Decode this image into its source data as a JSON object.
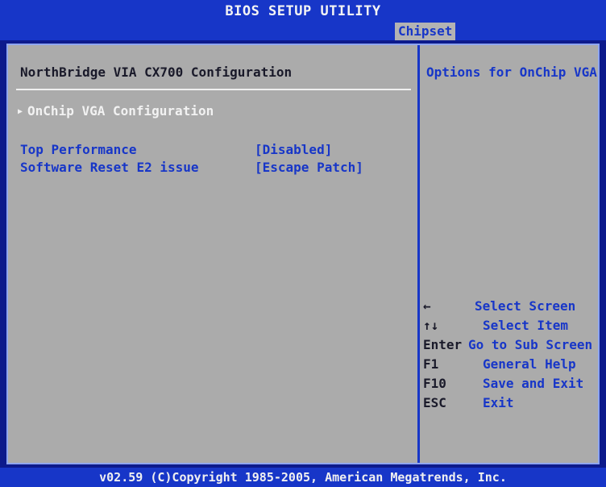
{
  "title": "BIOS SETUP UTILITY",
  "active_tab": "Chipset",
  "section_title": "NorthBridge VIA CX700 Configuration",
  "submenu": {
    "label": "OnChip VGA Configuration"
  },
  "settings": [
    {
      "label": "Top Performance",
      "value": "[Disabled]"
    },
    {
      "label": "Software Reset E2 issue",
      "value": "[Escape Patch]"
    }
  ],
  "help": "Options for OnChip VGA",
  "keys": [
    {
      "key": "←",
      "desc": "Select Screen"
    },
    {
      "key": "↑↓",
      "desc": "Select Item"
    },
    {
      "key": "Enter",
      "desc": "Go to Sub Screen"
    },
    {
      "key": "F1",
      "desc": "General Help"
    },
    {
      "key": "F10",
      "desc": "Save and Exit"
    },
    {
      "key": "ESC",
      "desc": "Exit"
    }
  ],
  "footer": "v02.59 (C)Copyright 1985-2005, American Megatrends, Inc.",
  "colors": {
    "frame_blue": "#1736c8",
    "panel_gray": "#ababab",
    "highlight_text": "#f2f2f2"
  }
}
